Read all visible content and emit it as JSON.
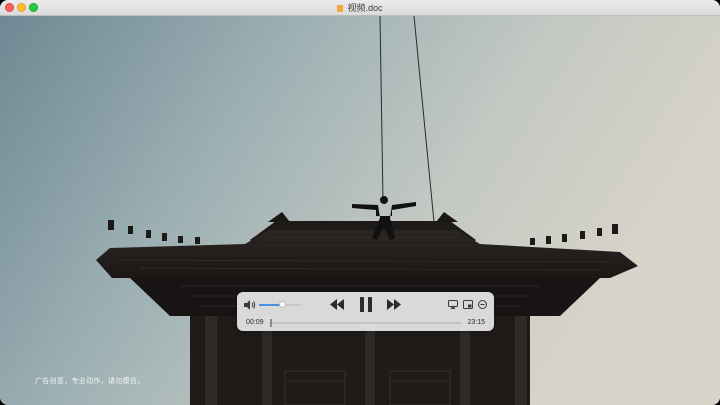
{
  "window": {
    "title": "视频.doc",
    "buttons": [
      "close",
      "minimize",
      "zoom"
    ]
  },
  "video": {
    "subtitle": "广告创意，专业动作，请勿模仿。"
  },
  "controls": {
    "volume_level": 0.55,
    "progress_fraction": 0.0065,
    "elapsed": "00:09",
    "total": "23:15",
    "icons": {
      "volume": "speaker-icon",
      "rewind": "rewind-icon",
      "play_pause": "pause-icon",
      "forward": "fast-forward-icon",
      "airplay": "airplay-icon",
      "pip": "picture-in-picture-icon",
      "more": "more-options-icon"
    }
  },
  "colors": {
    "close": "#fe5f57",
    "minimize": "#febc2e",
    "zoom": "#28c840",
    "accent": "#4a90e2"
  }
}
